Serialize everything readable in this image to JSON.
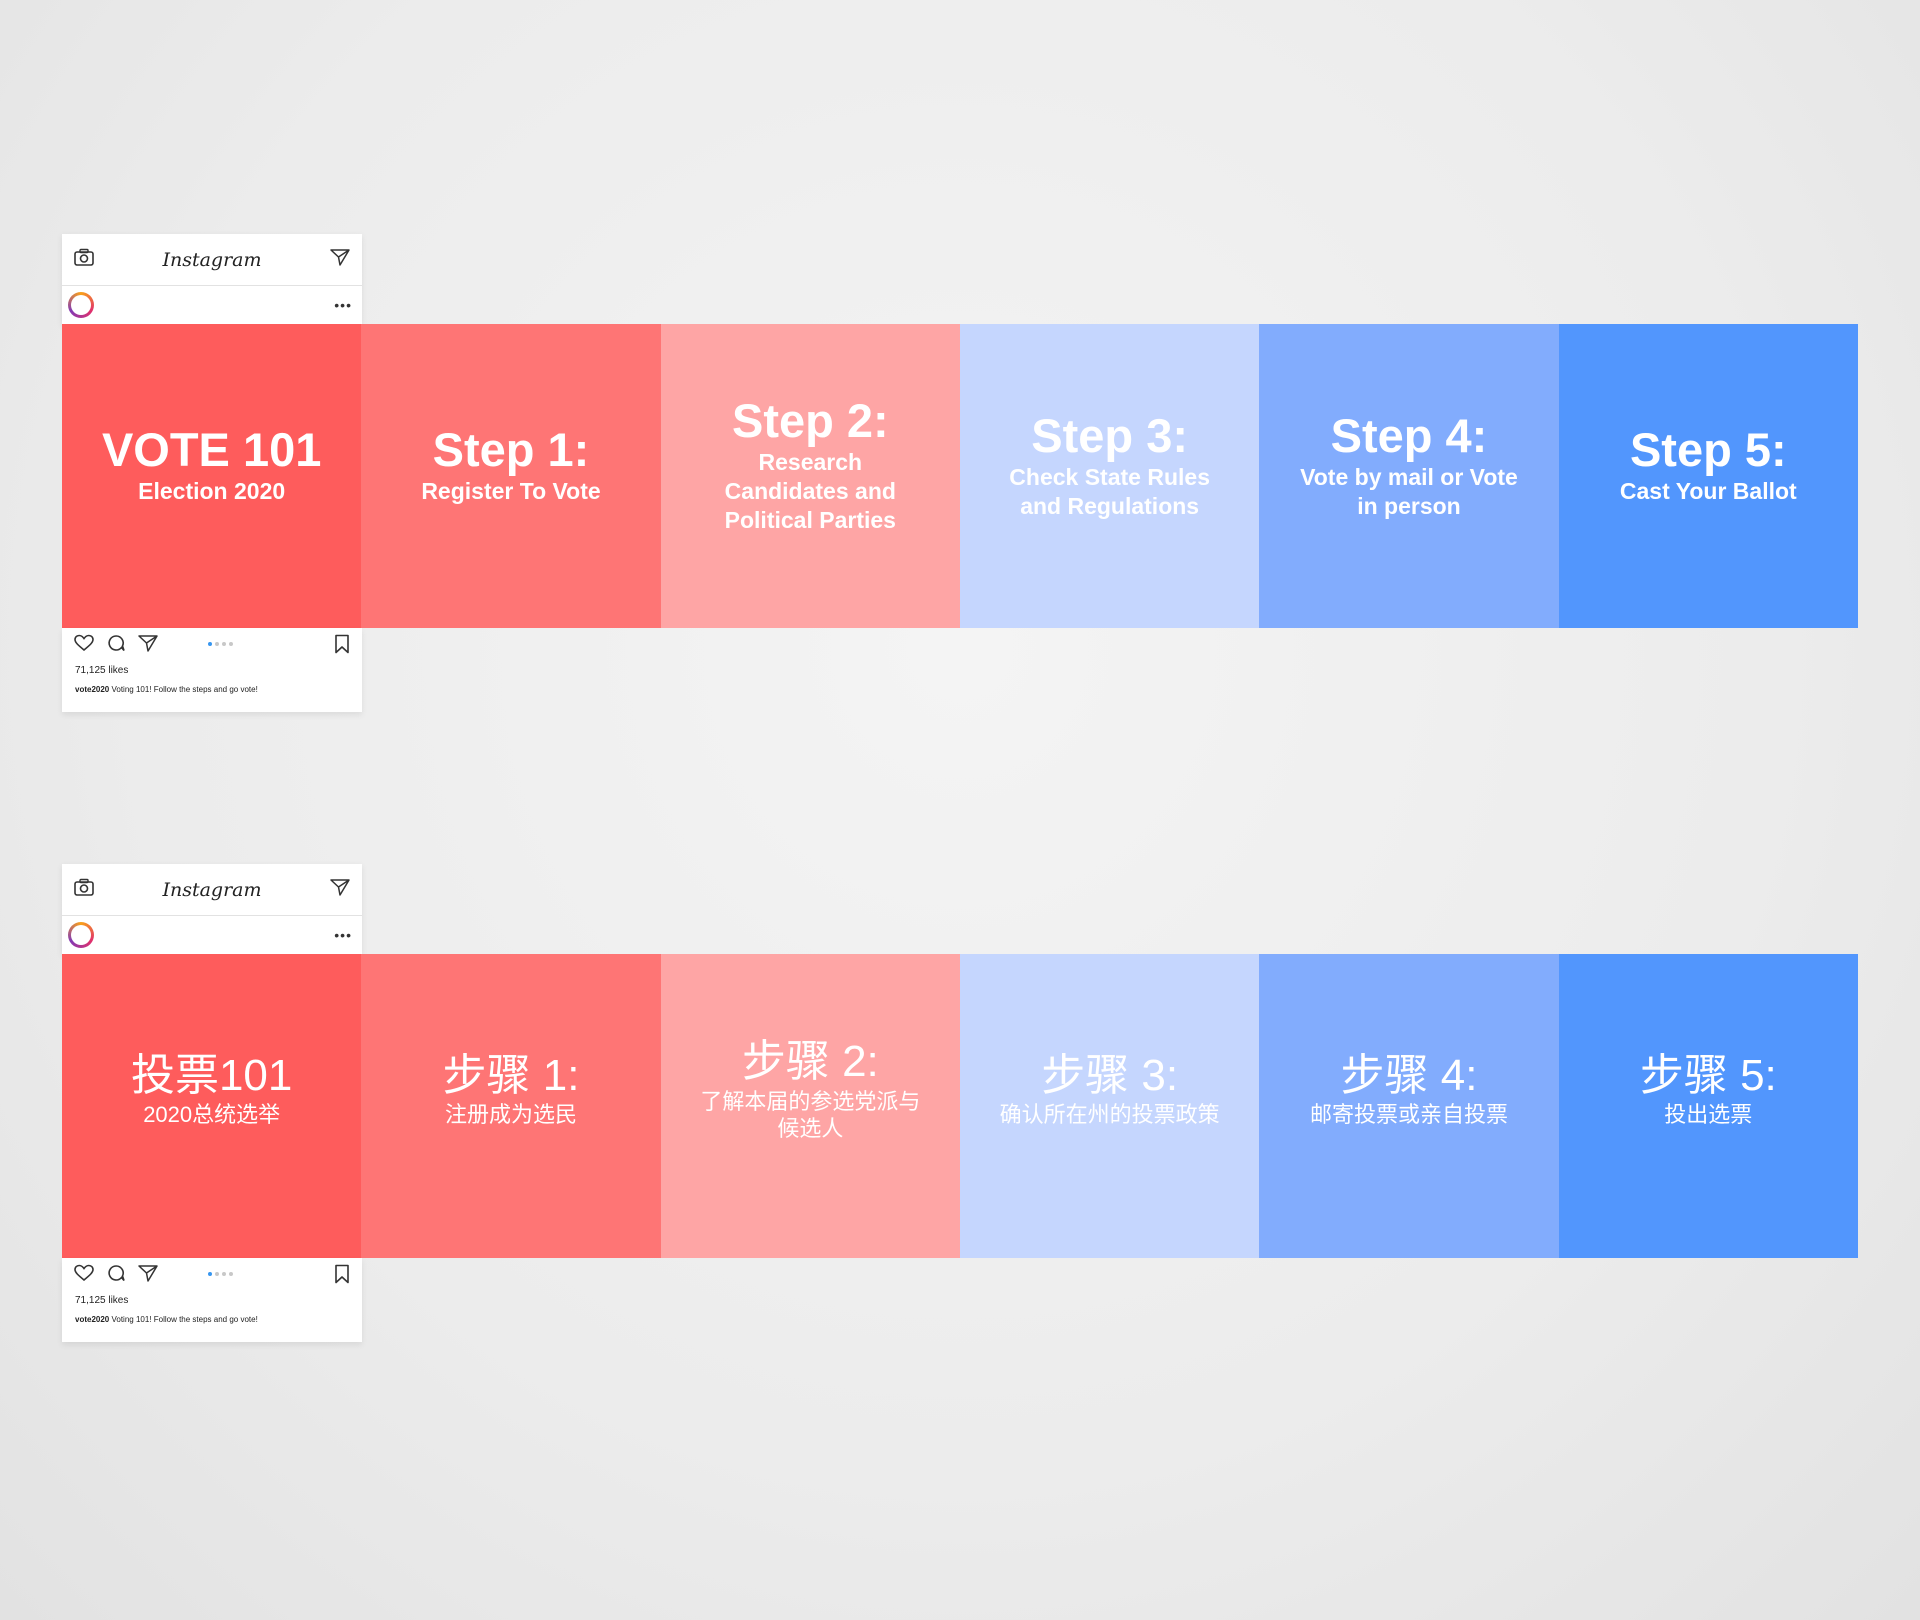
{
  "app": {
    "logo_text": "Instagram",
    "likes": "71,125 likes",
    "caption_user": "vote2020",
    "caption_text": "Voting 101! Follow the steps and go vote!",
    "icons": {
      "camera": "camera-icon",
      "direct": "paper-plane-icon",
      "more": "more-options-icon",
      "like": "heart-icon",
      "comment": "comment-icon",
      "share": "share-icon",
      "save": "bookmark-icon"
    },
    "carousel": {
      "total": 4,
      "active": 1
    }
  },
  "colors": [
    "#fe5c5c",
    "#fe7575",
    "#fea5a5",
    "#c5d6fe",
    "#82acfd",
    "#5296fd"
  ],
  "english": {
    "panels": [
      {
        "title": "VOTE 101",
        "subtitle": "Election 2020"
      },
      {
        "title": "Step 1:",
        "subtitle": "Register To Vote"
      },
      {
        "title": "Step 2:",
        "subtitle": "Research\nCandidates and\nPolitical Parties"
      },
      {
        "title": "Step 3:",
        "subtitle": "Check State Rules\nand Regulations"
      },
      {
        "title": "Step 4:",
        "subtitle": "Vote by mail or Vote\nin person"
      },
      {
        "title": "Step 5:",
        "subtitle": "Cast Your Ballot"
      }
    ]
  },
  "chinese": {
    "panels": [
      {
        "title": "投票101",
        "subtitle": "2020总统选举"
      },
      {
        "title": "步骤 1:",
        "subtitle": "注册成为选民"
      },
      {
        "title": "步骤 2:",
        "subtitle": "了解本届的参选党派与\n候选人"
      },
      {
        "title": "步骤 3:",
        "subtitle": "确认所在州的投票政策"
      },
      {
        "title": "步骤 4:",
        "subtitle": "邮寄投票或亲自投票"
      },
      {
        "title": "步骤 5:",
        "subtitle": "投出选票"
      }
    ]
  }
}
